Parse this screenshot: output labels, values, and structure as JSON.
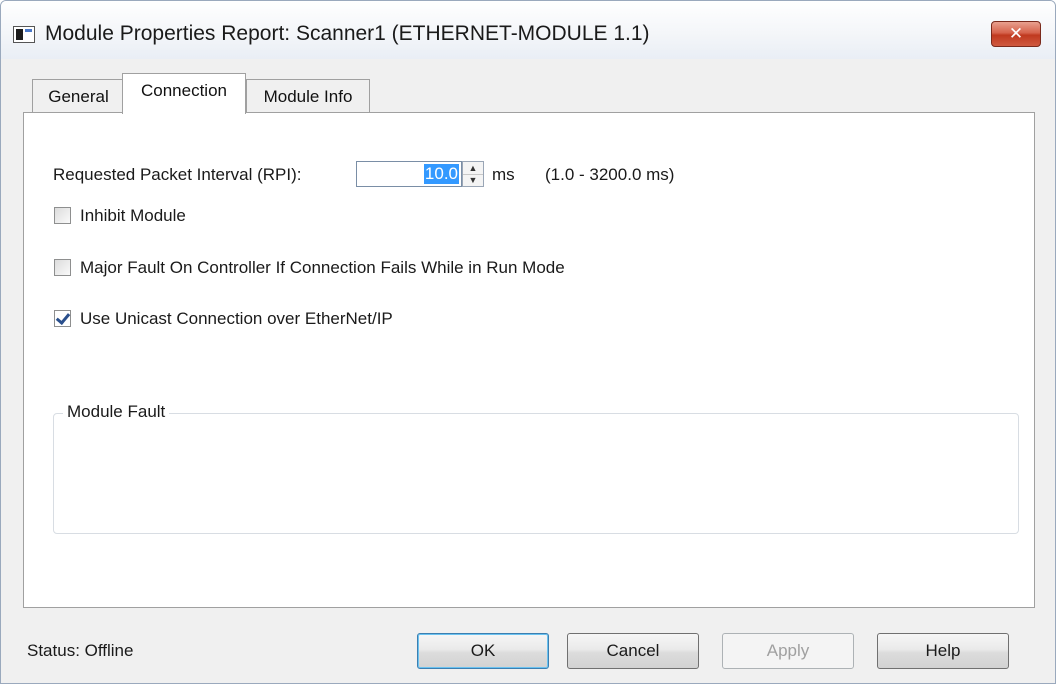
{
  "window": {
    "title": "Module Properties Report: Scanner1 (ETHERNET-MODULE 1.1)",
    "close_glyph": "✕"
  },
  "tabs": [
    {
      "label": "General",
      "active": false
    },
    {
      "label": "Connection",
      "active": true
    },
    {
      "label": "Module Info",
      "active": false
    }
  ],
  "connection": {
    "rpi_label": "Requested Packet Interval (RPI):",
    "rpi_value": "10.0",
    "rpi_unit": "ms",
    "rpi_range": "(1.0 - 3200.0 ms)",
    "options": [
      {
        "label": "Inhibit Module",
        "checked": false
      },
      {
        "label": "Major Fault On Controller If Connection Fails While in Run Mode",
        "checked": false
      },
      {
        "label": "Use Unicast Connection over EtherNet/IP",
        "checked": true
      }
    ],
    "module_fault_label": "Module Fault"
  },
  "status": {
    "text": "Status:  Offline"
  },
  "buttons": {
    "ok": "OK",
    "cancel": "Cancel",
    "apply": "Apply",
    "help": "Help"
  },
  "icons": {
    "spin_up": "▲",
    "spin_down": "▼"
  }
}
